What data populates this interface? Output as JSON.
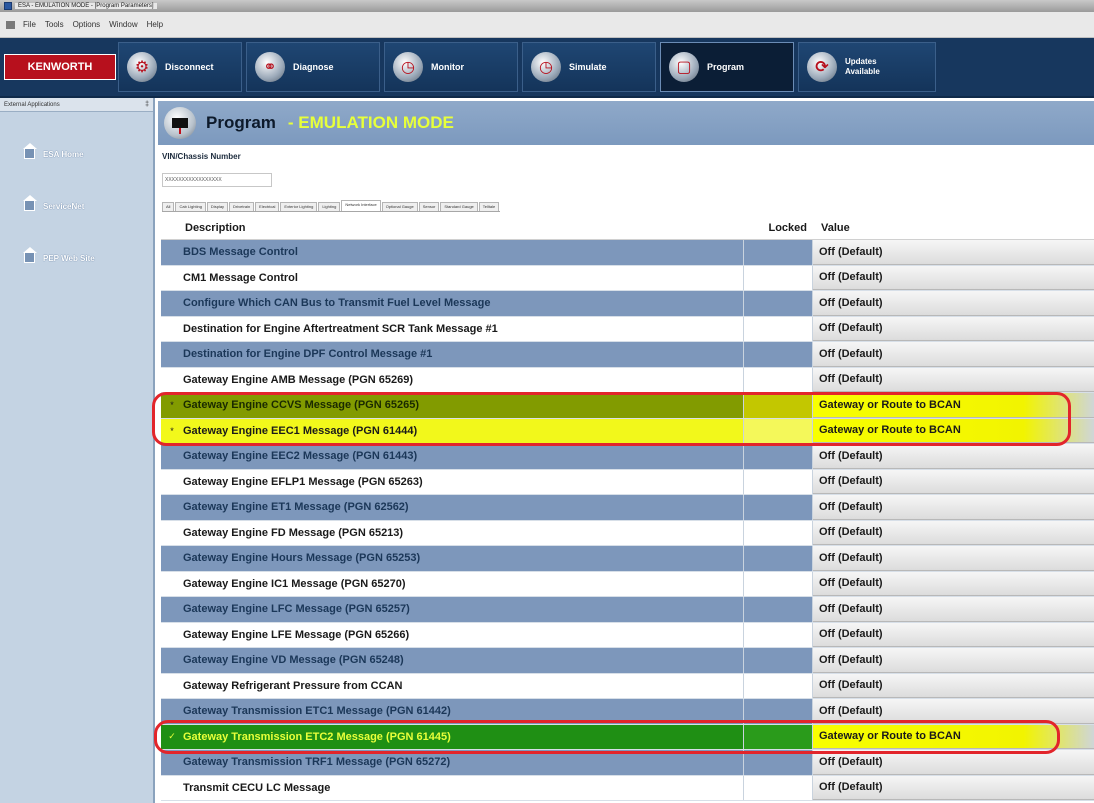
{
  "window": {
    "title": "ESA - EMULATION MODE - [Program Parameters]"
  },
  "menu": [
    "File",
    "Tools",
    "Options",
    "Window",
    "Help"
  ],
  "toolbar": {
    "brand": "KENWORTH",
    "buttons": [
      {
        "label": "Disconnect"
      },
      {
        "label": "Diagnose"
      },
      {
        "label": "Monitor"
      },
      {
        "label": "Simulate"
      },
      {
        "label": "Program"
      },
      {
        "label": "Updates\nAvailable"
      }
    ]
  },
  "sidebar": {
    "header": "External Applications",
    "pin": "‡",
    "items": [
      {
        "label": "ESA Home"
      },
      {
        "label": "ServiceNet"
      },
      {
        "label": "PEP Web Site"
      }
    ]
  },
  "main": {
    "title": "Program",
    "mode": "- EMULATION MODE",
    "vin_label": "VIN/Chassis Number",
    "vin_value": "XXXXXXXXXXXXXXXXX"
  },
  "tabs": [
    "All",
    "Cab Lighting",
    "Display",
    "Drivetrain",
    "Electrical",
    "Exterior Lighting",
    "Lighting",
    "Network Interface",
    "Optional Gauge",
    "Sensor",
    "Standard Gauge",
    "Telltale"
  ],
  "grid": {
    "headers": {
      "description": "Description",
      "locked": "Locked",
      "value": "Value"
    },
    "rows": [
      {
        "star": "",
        "description": "BDS Message Control",
        "value": "Off (Default)"
      },
      {
        "star": "",
        "description": "CM1 Message Control",
        "value": "Off (Default)"
      },
      {
        "star": "",
        "description": "Configure Which CAN Bus to Transmit Fuel Level Message",
        "value": "Off (Default)"
      },
      {
        "star": "",
        "description": "Destination for Engine Aftertreatment SCR Tank Message #1",
        "value": "Off (Default)"
      },
      {
        "star": "",
        "description": "Destination for Engine DPF Control Message #1",
        "value": "Off (Default)"
      },
      {
        "star": "",
        "description": "Gateway Engine AMB Message (PGN 65269)",
        "value": "Off (Default)"
      },
      {
        "star": "*",
        "description": "Gateway Engine CCVS Message (PGN 65265)",
        "value": "Gateway or Route to BCAN"
      },
      {
        "star": "*",
        "description": "Gateway Engine EEC1 Message (PGN 61444)",
        "value": "Gateway or Route to BCAN"
      },
      {
        "star": "",
        "description": "Gateway Engine EEC2 Message (PGN 61443)",
        "value": "Off (Default)"
      },
      {
        "star": "",
        "description": "Gateway Engine EFLP1 Message (PGN 65263)",
        "value": "Off (Default)"
      },
      {
        "star": "",
        "description": "Gateway Engine ET1 Message (PGN 62562)",
        "value": "Off (Default)"
      },
      {
        "star": "",
        "description": "Gateway Engine FD Message (PGN 65213)",
        "value": "Off (Default)"
      },
      {
        "star": "",
        "description": "Gateway Engine Hours Message (PGN 65253)",
        "value": "Off (Default)"
      },
      {
        "star": "",
        "description": "Gateway Engine IC1 Message (PGN 65270)",
        "value": "Off (Default)"
      },
      {
        "star": "",
        "description": "Gateway Engine LFC Message (PGN 65257)",
        "value": "Off (Default)"
      },
      {
        "star": "",
        "description": "Gateway Engine LFE Message (PGN 65266)",
        "value": "Off (Default)"
      },
      {
        "star": "",
        "description": "Gateway Engine VD Message (PGN 65248)",
        "value": "Off (Default)"
      },
      {
        "star": "",
        "description": "Gateway Refrigerant Pressure from CCAN",
        "value": "Off (Default)"
      },
      {
        "star": "",
        "description": "Gateway Transmission ETC1 Message (PGN 61442)",
        "value": "Off (Default)"
      },
      {
        "star": "✓",
        "description": "Gateway Transmission ETC2 Message (PGN 61445)",
        "value": "Gateway or Route to BCAN"
      },
      {
        "star": "",
        "description": "Gateway Transmission TRF1 Message (PGN 65272)",
        "value": "Off (Default)"
      },
      {
        "star": "",
        "description": "Transmit CECU LC Message",
        "value": "Off (Default)"
      }
    ]
  },
  "colors": {
    "toolbar": "#17375e",
    "brand": "#b7101d",
    "row_blue": "#7d97bb",
    "row_olive": "#829b00",
    "row_yellow": "#f2f81b",
    "row_green": "#1f8f14",
    "highlight_ring": "#e2252b",
    "mode_text": "#e7ff3a"
  }
}
